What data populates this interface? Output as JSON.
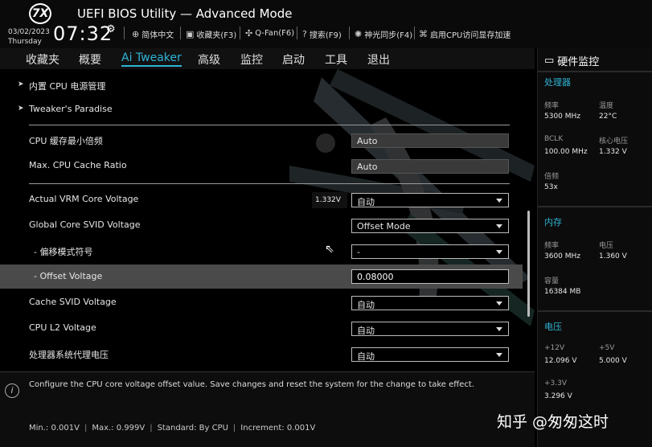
{
  "header": {
    "logo_text": "7X",
    "title": "UEFI BIOS Utility — Advanced Mode",
    "date": "03/02/2023",
    "weekday": "Thursday",
    "time": "07:32",
    "toolbar": [
      {
        "icon": "globe-icon",
        "glyph": "⊕",
        "label": "简体中文"
      },
      {
        "icon": "favorites-icon",
        "glyph": "▣",
        "label": "收藏夹(F3)"
      },
      {
        "icon": "fan-icon",
        "glyph": "✣",
        "label": "Q-Fan(F6)"
      },
      {
        "icon": "search-help-icon",
        "glyph": "?",
        "label": "搜索(F9)"
      },
      {
        "icon": "sync-light-icon",
        "glyph": "✺",
        "label": "神光同步(F4)"
      },
      {
        "icon": "memory-icon",
        "glyph": "⌘",
        "label": "启用CPU访问显存加速"
      }
    ]
  },
  "nav": {
    "tabs": [
      "收藏夹",
      "概要",
      "Ai Tweaker",
      "高级",
      "监控",
      "启动",
      "工具",
      "退出"
    ],
    "active": "Ai Tweaker"
  },
  "menus": [
    "内置 CPU 电源管理",
    "Tweaker's Paradise"
  ],
  "settings": {
    "cpu_cache_min_ratio": {
      "label": "CPU 缓存最小倍频",
      "value": "Auto"
    },
    "max_cpu_cache_ratio": {
      "label": "Max. CPU Cache Ratio",
      "value": "Auto"
    },
    "actual_vrm_core_voltage": {
      "label": "Actual VRM Core Voltage",
      "reading": "1.332V",
      "value": "自动"
    },
    "global_core_svid_voltage": {
      "label": "Global Core SVID Voltage",
      "value": "Offset Mode"
    },
    "offset_sign": {
      "label": "- 偏移模式符号",
      "value": "-"
    },
    "offset_voltage": {
      "label": "- Offset Voltage",
      "value": "0.08000"
    },
    "cache_svid_voltage": {
      "label": "Cache SVID Voltage",
      "value": "自动"
    },
    "cpu_l2_voltage": {
      "label": "CPU L2 Voltage",
      "value": "自动"
    },
    "system_agent_voltage": {
      "label": "处理器系统代理电压",
      "value": "自动"
    }
  },
  "help": {
    "description": "Configure the CPU core voltage offset value. Save changes and reset the system for the change to take effect.",
    "min": "Min.: 0.001V",
    "max": "Max.: 0.999V",
    "standard": "Standard: By CPU",
    "increment": "Increment: 0.001V"
  },
  "monitor": {
    "title": "硬件监控",
    "cpu": {
      "section": "处理器",
      "freq_label": "频率",
      "freq": "5300 MHz",
      "temp_label": "温度",
      "temp": "22°C",
      "bclk_label": "BCLK",
      "bclk": "100.00 MHz",
      "core_v_label": "核心电压",
      "core_v": "1.332 V",
      "ratio_label": "倍频",
      "ratio": "53x"
    },
    "memory": {
      "section": "内存",
      "freq_label": "频率",
      "freq": "3600 MHz",
      "volt_label": "电压",
      "volt": "1.360 V",
      "cap_label": "容量",
      "cap": "16384 MB"
    },
    "voltage": {
      "section": "电压",
      "v12_label": "+12V",
      "v12": "12.096 V",
      "v5_label": "+5V",
      "v5": "5.000 V",
      "v33_label": "+3.3V",
      "v33": "3.296 V"
    }
  },
  "watermark": "知乎 @匆匆这时"
}
